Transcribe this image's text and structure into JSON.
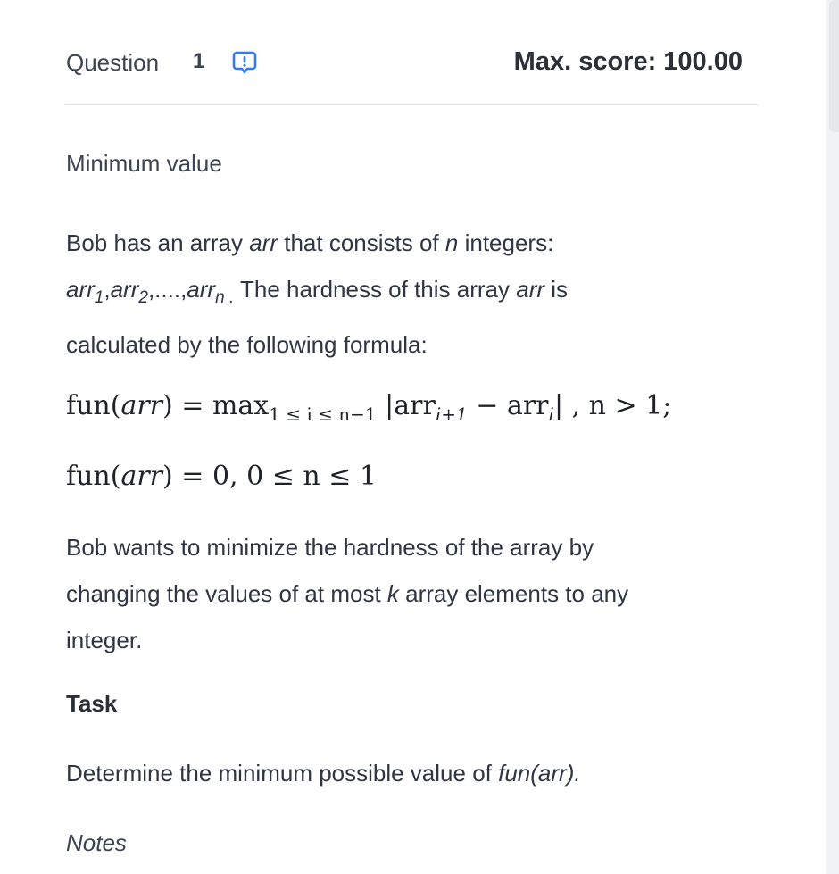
{
  "header": {
    "question_label": "Question",
    "question_number": "1",
    "report_icon": "report-issue-icon",
    "max_score": "Max. score: 100.00"
  },
  "problem": {
    "title": "Minimum value",
    "intro": {
      "t1": "Bob has an array ",
      "arr1": "arr",
      "t2": " that consists of ",
      "n1": "n",
      "t3": " integers:",
      "a_1": "arr",
      "s_1": "1",
      "c1": ",",
      "a_2": "arr",
      "s_2": "2",
      "dots": ",....,",
      "a_n": "arr",
      "s_n": "n",
      "period": " .",
      "t4": " The hardness of this array ",
      "arr2": "arr",
      "t5": " is",
      "t6": "calculated by the following formula:"
    },
    "formula1": {
      "fn": "fun(",
      "arg": "arr",
      "rp": ") = max",
      "range": "1 ≤ i ≤ n−1",
      "abs1": " |arr",
      "sub1": "i+1",
      "minus": " − arr",
      "sub2": "i",
      "tail": "| , n > 1;"
    },
    "formula2": {
      "fn": "fun(",
      "arg": "arr",
      "tail": ") = 0, 0 ≤ n ≤ 1"
    },
    "para2": {
      "t1": "Bob wants to minimize the hardness of the array by",
      "t2": "changing the values of at most ",
      "k": "k",
      "t3": " array elements to any",
      "t4": "integer."
    },
    "task_heading": "Task",
    "task": {
      "t1": "Determine the minimum possible value of ",
      "fn": "fun(arr)."
    },
    "notes_heading": "Notes"
  },
  "colors": {
    "text": "#2f3542",
    "heading": "#2b2f38",
    "accent_icon": "#2f7df6",
    "divider": "#e4e6ea"
  }
}
